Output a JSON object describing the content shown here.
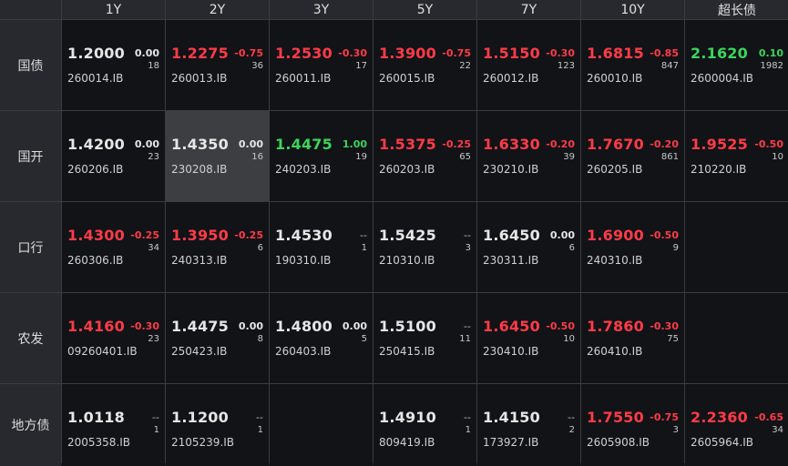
{
  "columns": [
    "1Y",
    "2Y",
    "3Y",
    "5Y",
    "7Y",
    "10Y",
    "超长债"
  ],
  "rows": [
    {
      "label": "国债",
      "cells": [
        {
          "yield": "1.2000",
          "change": "0.00",
          "count": "18",
          "code": "260014.IB",
          "dir": "flat"
        },
        {
          "yield": "1.2275",
          "change": "-0.75",
          "count": "36",
          "code": "260013.IB",
          "dir": "down"
        },
        {
          "yield": "1.2530",
          "change": "-0.30",
          "count": "17",
          "code": "260011.IB",
          "dir": "down"
        },
        {
          "yield": "1.3900",
          "change": "-0.75",
          "count": "22",
          "code": "260015.IB",
          "dir": "down"
        },
        {
          "yield": "1.5150",
          "change": "-0.30",
          "count": "123",
          "code": "260012.IB",
          "dir": "down"
        },
        {
          "yield": "1.6815",
          "change": "-0.85",
          "count": "847",
          "code": "260010.IB",
          "dir": "down"
        },
        {
          "yield": "2.1620",
          "change": "0.10",
          "count": "1982",
          "code": "2600004.IB",
          "dir": "up"
        }
      ]
    },
    {
      "label": "国开",
      "cells": [
        {
          "yield": "1.4200",
          "change": "0.00",
          "count": "23",
          "code": "260206.IB",
          "dir": "flat"
        },
        {
          "yield": "1.4350",
          "change": "0.00",
          "count": "16",
          "code": "230208.IB",
          "dir": "flat",
          "highlight": true
        },
        {
          "yield": "1.4475",
          "change": "1.00",
          "count": "19",
          "code": "240203.IB",
          "dir": "up"
        },
        {
          "yield": "1.5375",
          "change": "-0.25",
          "count": "65",
          "code": "260203.IB",
          "dir": "down"
        },
        {
          "yield": "1.6330",
          "change": "-0.20",
          "count": "39",
          "code": "230210.IB",
          "dir": "down"
        },
        {
          "yield": "1.7670",
          "change": "-0.20",
          "count": "861",
          "code": "260205.IB",
          "dir": "down"
        },
        {
          "yield": "1.9525",
          "change": "-0.50",
          "count": "10",
          "code": "210220.IB",
          "dir": "down"
        }
      ]
    },
    {
      "label": "口行",
      "cells": [
        {
          "yield": "1.4300",
          "change": "-0.25",
          "count": "34",
          "code": "260306.IB",
          "dir": "down"
        },
        {
          "yield": "1.3950",
          "change": "-0.25",
          "count": "6",
          "code": "240313.IB",
          "dir": "down"
        },
        {
          "yield": "1.4530",
          "change": "--",
          "count": "1",
          "code": "190310.IB",
          "dir": "none"
        },
        {
          "yield": "1.5425",
          "change": "--",
          "count": "3",
          "code": "210310.IB",
          "dir": "none"
        },
        {
          "yield": "1.6450",
          "change": "0.00",
          "count": "6",
          "code": "230311.IB",
          "dir": "flat"
        },
        {
          "yield": "1.6900",
          "change": "-0.50",
          "count": "9",
          "code": "240310.IB",
          "dir": "down"
        },
        null
      ]
    },
    {
      "label": "农发",
      "cells": [
        {
          "yield": "1.4160",
          "change": "-0.30",
          "count": "23",
          "code": "09260401.IB",
          "dir": "down"
        },
        {
          "yield": "1.4475",
          "change": "0.00",
          "count": "8",
          "code": "250423.IB",
          "dir": "flat"
        },
        {
          "yield": "1.4800",
          "change": "0.00",
          "count": "5",
          "code": "260403.IB",
          "dir": "flat"
        },
        {
          "yield": "1.5100",
          "change": "--",
          "count": "11",
          "code": "250415.IB",
          "dir": "none"
        },
        {
          "yield": "1.6450",
          "change": "-0.50",
          "count": "10",
          "code": "230410.IB",
          "dir": "down"
        },
        {
          "yield": "1.7860",
          "change": "-0.30",
          "count": "75",
          "code": "260410.IB",
          "dir": "down"
        },
        null
      ]
    },
    {
      "label": "地方债",
      "cells": [
        {
          "yield": "1.0118",
          "change": "--",
          "count": "1",
          "code": "2005358.IB",
          "dir": "none"
        },
        {
          "yield": "1.1200",
          "change": "--",
          "count": "1",
          "code": "2105239.IB",
          "dir": "none"
        },
        null,
        {
          "yield": "1.4910",
          "change": "--",
          "count": "1",
          "code": "809419.IB",
          "dir": "none"
        },
        {
          "yield": "1.4150",
          "change": "--",
          "count": "2",
          "code": "173927.IB",
          "dir": "none"
        },
        {
          "yield": "1.7550",
          "change": "-0.75",
          "count": "3",
          "code": "2605908.IB",
          "dir": "down"
        },
        {
          "yield": "2.2360",
          "change": "-0.65",
          "count": "34",
          "code": "2605964.IB",
          "dir": "down"
        }
      ]
    }
  ],
  "colors": {
    "up": "#3ad65a",
    "down": "#ff3b47",
    "flat": "#e6e6e6",
    "background": "#111317",
    "header": "#27292e",
    "highlight": "#3d3e42"
  }
}
